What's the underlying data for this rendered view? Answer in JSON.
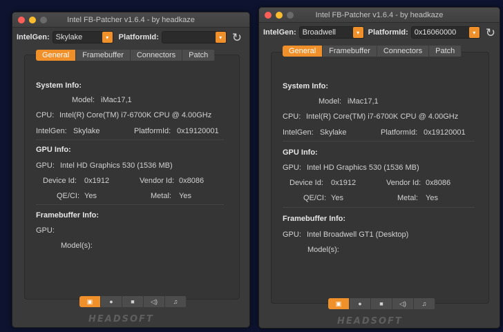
{
  "windows": [
    {
      "title": "Intel FB-Patcher v1.6.4 - by headkaze",
      "toolbar": {
        "intelgen_label": "IntelGen:",
        "intelgen_value": "Skylake",
        "platformid_label": "PlatformId:",
        "platformid_value": "",
        "refresh_icon": "refresh-icon"
      },
      "tabs": [
        "General",
        "Framebuffer",
        "Connectors",
        "Patch"
      ],
      "active_tab": "General",
      "system_info": {
        "heading": "System Info:",
        "model_label": "Model:",
        "model_value": "iMac17,1",
        "cpu_label": "CPU:",
        "cpu_value": "Intel(R) Core(TM) i7-6700K CPU @ 4.00GHz",
        "intelgen_label": "IntelGen:",
        "intelgen_value": "Skylake",
        "platformid_label": "PlatformId:",
        "platformid_value": "0x19120001"
      },
      "gpu_info": {
        "heading": "GPU Info:",
        "gpu_label": "GPU:",
        "gpu_value": "Intel HD Graphics 530 (1536 MB)",
        "device_id_label": "Device Id:",
        "device_id_value": "0x1912",
        "vendor_id_label": "Vendor Id:",
        "vendor_id_value": "0x8086",
        "qeci_label": "QE/CI:",
        "qeci_value": "Yes",
        "metal_label": "Metal:",
        "metal_value": "Yes"
      },
      "framebuffer_info": {
        "heading": "Framebuffer Info:",
        "gpu_label": "GPU:",
        "gpu_value": "",
        "models_label": "Model(s):"
      },
      "bottom_buttons": [
        "display-icon",
        "shield-icon",
        "chip-icon",
        "speaker-icon",
        "music-icon"
      ],
      "logo": "HEADSOFT"
    },
    {
      "title": "Intel FB-Patcher v1.6.4 - by headkaze",
      "toolbar": {
        "intelgen_label": "IntelGen:",
        "intelgen_value": "Broadwell",
        "platformid_label": "PlatformId:",
        "platformid_value": "0x16060000",
        "refresh_icon": "refresh-icon"
      },
      "tabs": [
        "General",
        "Framebuffer",
        "Connectors",
        "Patch"
      ],
      "active_tab": "General",
      "system_info": {
        "heading": "System Info:",
        "model_label": "Model:",
        "model_value": "iMac17,1",
        "cpu_label": "CPU:",
        "cpu_value": "Intel(R) Core(TM) i7-6700K CPU @ 4.00GHz",
        "intelgen_label": "IntelGen:",
        "intelgen_value": "Skylake",
        "platformid_label": "PlatformId:",
        "platformid_value": "0x19120001"
      },
      "gpu_info": {
        "heading": "GPU Info:",
        "gpu_label": "GPU:",
        "gpu_value": "Intel HD Graphics 530 (1536 MB)",
        "device_id_label": "Device Id:",
        "device_id_value": "0x1912",
        "vendor_id_label": "Vendor Id:",
        "vendor_id_value": "0x8086",
        "qeci_label": "QE/CI:",
        "qeci_value": "Yes",
        "metal_label": "Metal:",
        "metal_value": "Yes"
      },
      "framebuffer_info": {
        "heading": "Framebuffer Info:",
        "gpu_label": "GPU:",
        "gpu_value": "Intel Broadwell GT1 (Desktop)",
        "models_label": "Model(s):"
      },
      "bottom_buttons": [
        "display-icon",
        "shield-icon",
        "chip-icon",
        "speaker-icon",
        "music-icon"
      ],
      "logo": "HEADSOFT"
    }
  ],
  "colors": {
    "accent": "#f0902a",
    "window_bg": "#3a3a3a",
    "desktop_bg": "#0e1430"
  }
}
